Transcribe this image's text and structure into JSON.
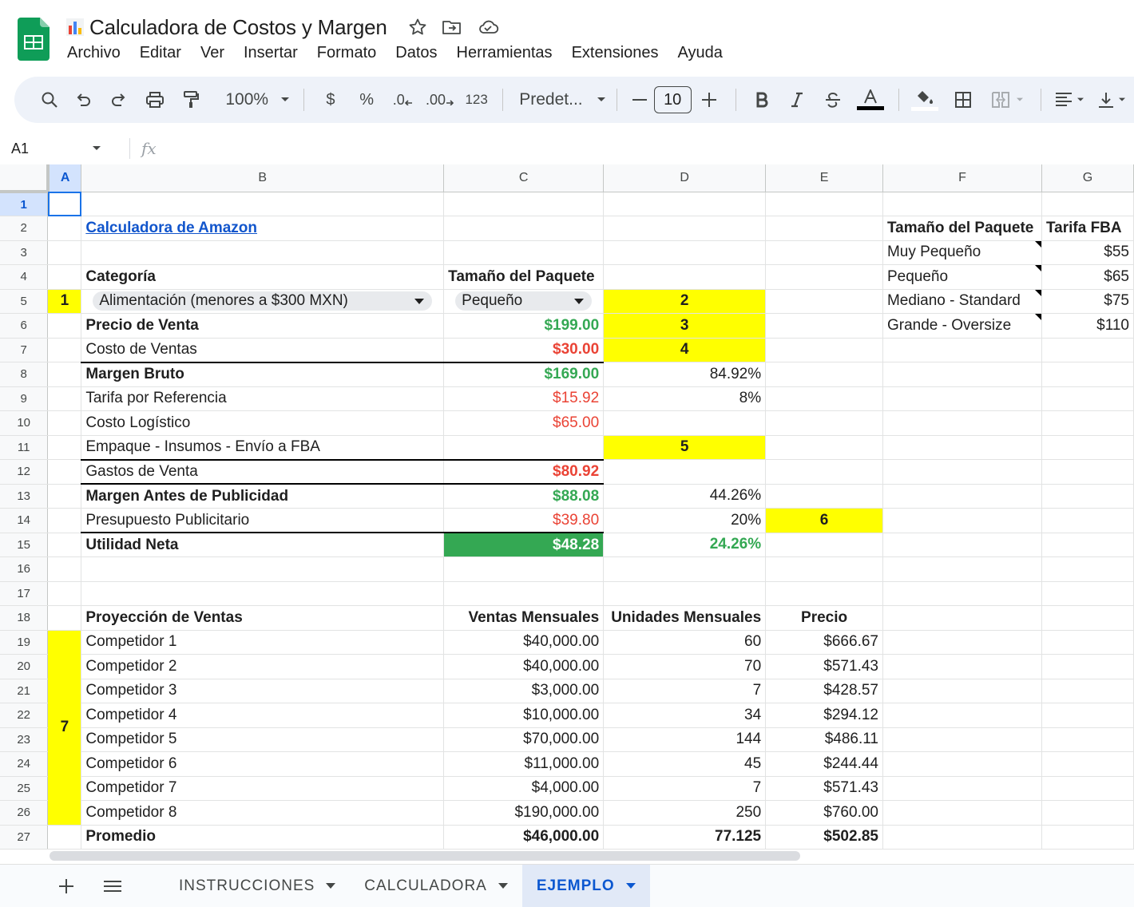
{
  "app": {
    "title": "Calculadora de Costos y Margen",
    "menu": [
      "Archivo",
      "Editar",
      "Ver",
      "Insertar",
      "Formato",
      "Datos",
      "Herramientas",
      "Extensiones",
      "Ayuda"
    ]
  },
  "toolbar": {
    "zoom": "100%",
    "currency": "$",
    "percent": "%",
    "dec_decrease": ".0",
    "dec_increase": ".00",
    "number_format": "123",
    "font": "Predet...",
    "font_size": "10"
  },
  "formula_bar": {
    "name_box": "A1",
    "fx": "fx"
  },
  "columns": [
    "A",
    "B",
    "C",
    "D",
    "E",
    "F",
    "G"
  ],
  "rows": {
    "r2": {
      "b": "Calculadora de Amazon",
      "f": "Tamaño del Paquete",
      "g": "Tarifa FBA"
    },
    "r3": {
      "f": "Muy Pequeño",
      "g": "$55"
    },
    "r4": {
      "b": "Categoría",
      "c": "Tamaño del Paquete",
      "f": "Pequeño",
      "g": "$65"
    },
    "r5": {
      "a": "1",
      "b": "Alimentación (menores a $300 MXN)",
      "c": "Pequeño",
      "d": "2",
      "f": "Mediano - Standard",
      "g": "$75"
    },
    "r6": {
      "b": "Precio de Venta",
      "c": "$199.00",
      "d": "3",
      "f": "Grande - Oversize",
      "g": "$110"
    },
    "r7": {
      "b": "Costo de Ventas",
      "c": "$30.00",
      "d": "4"
    },
    "r8": {
      "b": "Margen Bruto",
      "c": "$169.00",
      "d": "84.92%"
    },
    "r9": {
      "b": "Tarifa por Referencia",
      "c": "$15.92",
      "d": "8%"
    },
    "r10": {
      "b": "Costo Logístico",
      "c": "$65.00"
    },
    "r11": {
      "b": "Empaque - Insumos - Envío a FBA",
      "d": "5"
    },
    "r12": {
      "b": "Gastos de Venta",
      "c": "$80.92"
    },
    "r13": {
      "b": "Margen Antes de Publicidad",
      "c": "$88.08",
      "d": "44.26%"
    },
    "r14": {
      "b": "Presupuesto Publicitario",
      "c": "$39.80",
      "d": "20%",
      "e": "6"
    },
    "r15": {
      "b": "Utilidad Neta",
      "c": "$48.28",
      "d": "24.26%"
    },
    "r18": {
      "b": "Proyección de Ventas",
      "c": "Ventas Mensuales",
      "d": "Unidades Mensuales",
      "e": "Precio"
    },
    "marker7": "7",
    "competitors": [
      {
        "name": "Competidor 1",
        "sales": "$40,000.00",
        "units": "60",
        "price": "$666.67"
      },
      {
        "name": "Competidor 2",
        "sales": "$40,000.00",
        "units": "70",
        "price": "$571.43"
      },
      {
        "name": "Competidor 3",
        "sales": "$3,000.00",
        "units": "7",
        "price": "$428.57"
      },
      {
        "name": "Competidor 4",
        "sales": "$10,000.00",
        "units": "34",
        "price": "$294.12"
      },
      {
        "name": "Competidor 5",
        "sales": "$70,000.00",
        "units": "144",
        "price": "$486.11"
      },
      {
        "name": "Competidor 6",
        "sales": "$11,000.00",
        "units": "45",
        "price": "$244.44"
      },
      {
        "name": "Competidor 7",
        "sales": "$4,000.00",
        "units": "7",
        "price": "$571.43"
      },
      {
        "name": "Competidor 8",
        "sales": "$190,000.00",
        "units": "250",
        "price": "$760.00"
      }
    ],
    "r27": {
      "b": "Promedio",
      "c": "$46,000.00",
      "d": "77.125",
      "e": "$502.85"
    }
  },
  "tabs": [
    {
      "label": "INSTRUCCIONES"
    },
    {
      "label": "CALCULADORA"
    },
    {
      "label": "EJEMPLO",
      "active": true
    }
  ],
  "colors": {
    "green": "#34a853",
    "red": "#ea4335",
    "yellow": "#ffff00",
    "link": "#1155cc",
    "accent": "#0b57d0"
  }
}
